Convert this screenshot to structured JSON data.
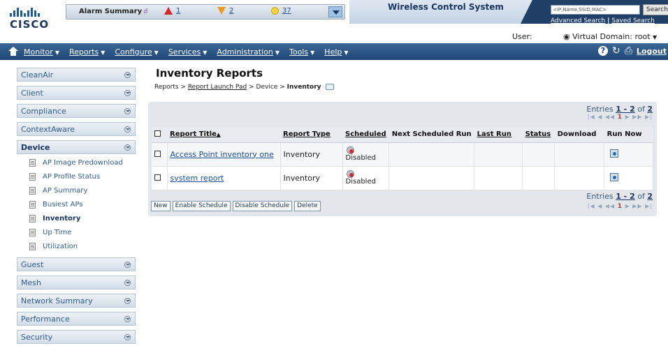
{
  "header": {
    "logo_text": "CISCO",
    "alarm_summary": {
      "title": "Alarm Summary",
      "critical": "1",
      "major": "2",
      "minor": "37"
    },
    "app_title": "Wireless Control System",
    "search_placeholder": "<IP,Name,SSID,MAC>",
    "search_button": "Search",
    "advanced_search": "Advanced Search",
    "link_separator": "|",
    "saved_search": "Saved Search",
    "user_label": "User:",
    "virtual_domain_label": "Virtual Domain:",
    "virtual_domain_value": "root"
  },
  "nav": {
    "menus": [
      "Monitor",
      "Reports",
      "Configure",
      "Services",
      "Administration",
      "Tools",
      "Help"
    ],
    "logout": "Logout"
  },
  "sidebar": {
    "sections_before": [
      "CleanAir",
      "Client",
      "Compliance",
      "ContextAware"
    ],
    "active_section": "Device",
    "device_items": [
      "AP Image Predownload",
      "AP Profile Status",
      "AP Summary",
      "Busiest APs",
      "Inventory",
      "Up Time",
      "Utilization"
    ],
    "sections_after": [
      "Guest",
      "Mesh",
      "Network Summary",
      "Performance",
      "Security"
    ]
  },
  "main": {
    "title": "Inventory Reports",
    "breadcrumb": {
      "reports": "Reports",
      "launch_pad": "Report Launch Pad",
      "device": "Device",
      "inventory": "Inventory",
      "separator": ">"
    },
    "entries_label": "Entries",
    "entries_range": "1 - 2",
    "entries_of": "of",
    "entries_total": "2",
    "current_page": "1",
    "columns": [
      "Report Title",
      "Report Type",
      "Scheduled",
      "Next Scheduled Run",
      "Last Run",
      "Status",
      "Download",
      "Run Now"
    ],
    "sort_indicator": "▲",
    "rows": [
      {
        "title": "Access Point inventory one",
        "type": "Inventory",
        "scheduled": "Disabled",
        "next_run": "",
        "last_run": "",
        "status": "",
        "download": ""
      },
      {
        "title": "system report",
        "type": "Inventory",
        "scheduled": "Disabled",
        "next_run": "",
        "last_run": "",
        "status": "",
        "download": ""
      }
    ],
    "buttons": [
      "New",
      "Enable Schedule",
      "Disable Schedule",
      "Delete"
    ]
  }
}
